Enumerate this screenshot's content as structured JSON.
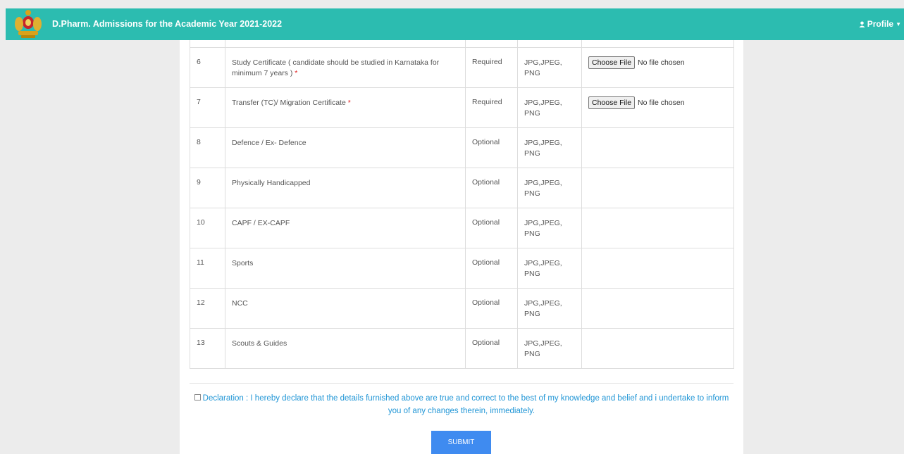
{
  "header": {
    "title": "D.Pharm. Admissions for the Academic Year 2021-2022",
    "profile_label": "Profile",
    "emblem_icon": "karnataka-emblem-icon"
  },
  "colors": {
    "header_bg": "#2cbcb0",
    "required_mark": "#e02020",
    "declaration_text": "#2196d6",
    "submit_bg": "#3f8bf0"
  },
  "documents": [
    {
      "no": "6",
      "name": "Study Certificate ( candidate should be studied in Karnataka for minimum 7 years )",
      "required_mark": "*",
      "status": "Required",
      "formats": "JPG,JPEG, PNG",
      "has_upload": true
    },
    {
      "no": "7",
      "name": "Transfer (TC)/ Migration Certificate",
      "required_mark": "*",
      "status": "Required",
      "formats": "JPG,JPEG, PNG",
      "has_upload": true
    },
    {
      "no": "8",
      "name": "Defence / Ex- Defence",
      "required_mark": "",
      "status": "Optional",
      "formats": "JPG,JPEG, PNG",
      "has_upload": false
    },
    {
      "no": "9",
      "name": "Physically Handicapped",
      "required_mark": "",
      "status": "Optional",
      "formats": "JPG,JPEG, PNG",
      "has_upload": false
    },
    {
      "no": "10",
      "name": "CAPF / EX-CAPF",
      "required_mark": "",
      "status": "Optional",
      "formats": "JPG,JPEG, PNG",
      "has_upload": false
    },
    {
      "no": "11",
      "name": "Sports",
      "required_mark": "",
      "status": "Optional",
      "formats": "JPG,JPEG, PNG",
      "has_upload": false
    },
    {
      "no": "12",
      "name": "NCC",
      "required_mark": "",
      "status": "Optional",
      "formats": "JPG,JPEG, PNG",
      "has_upload": false
    },
    {
      "no": "13",
      "name": "Scouts & Guides",
      "required_mark": "",
      "status": "Optional",
      "formats": "JPG,JPEG, PNG",
      "has_upload": false
    }
  ],
  "file_input": {
    "button_label": "Choose File",
    "status_text": "No file chosen"
  },
  "declaration": {
    "text": "Declaration : I hereby declare that the details furnished above are true and correct to the best of my knowledge and belief and i undertake to inform you of any changes therein, immediately.",
    "checked": false
  },
  "submit_label": "SUBMIT"
}
